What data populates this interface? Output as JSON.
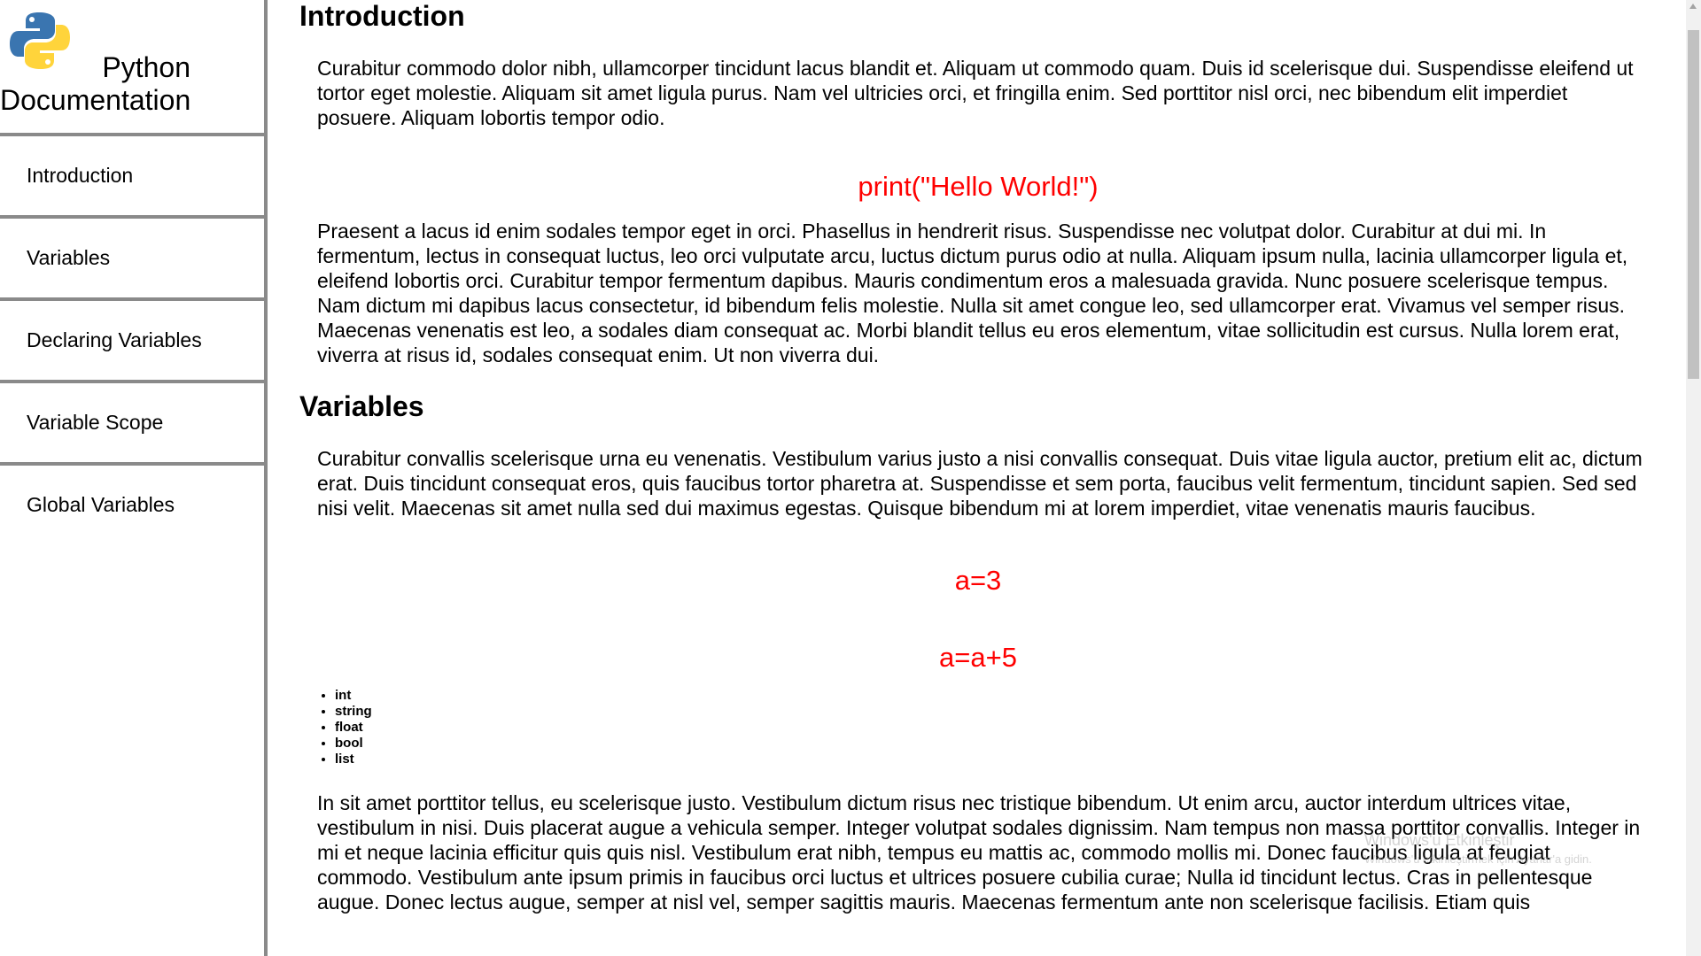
{
  "sidebar": {
    "title": "Python Documentation",
    "logo": "python-logo",
    "items": [
      {
        "label": "Introduction"
      },
      {
        "label": "Variables"
      },
      {
        "label": "Declaring Variables"
      },
      {
        "label": "Variable Scope"
      },
      {
        "label": "Global Variables"
      }
    ]
  },
  "main": {
    "introduction": {
      "title": "Introduction",
      "para1": "Curabitur commodo dolor nibh, ullamcorper tincidunt lacus blandit et. Aliquam ut commodo quam. Duis id scelerisque dui. Suspendisse eleifend ut tortor eget molestie. Aliquam sit amet ligula purus. Nam vel ultricies orci, et fringilla enim. Sed porttitor nisl orci, nec bibendum elit imperdiet posuere. Aliquam lobortis tempor odio.",
      "code": "print(\"Hello World!\")",
      "para2": "Praesent a lacus id enim sodales tempor eget in orci. Phasellus in hendrerit risus. Suspendisse nec volutpat dolor. Curabitur at dui mi. In fermentum, lectus in consequat luctus, leo orci vulputate arcu, luctus dictum purus odio at nulla. Aliquam ipsum nulla, lacinia ullamcorper ligula et, eleifend lobortis orci. Curabitur tempor fermentum dapibus. Mauris condimentum eros a malesuada gravida. Nunc posuere scelerisque tempus. Nam dictum mi dapibus lacus consectetur, id bibendum felis molestie. Nulla sit amet congue leo, sed ullamcorper erat. Vivamus vel semper risus. Maecenas venenatis est leo, a sodales diam consequat ac. Morbi blandit tellus eu eros elementum, vitae sollicitudin est cursus. Nulla lorem erat, viverra at risus id, sodales consequat enim. Ut non viverra dui."
    },
    "variables": {
      "title": "Variables",
      "para1": "Curabitur convallis scelerisque urna eu venenatis. Vestibulum varius justo a nisi convallis consequat. Duis vitae ligula auctor, pretium elit ac, dictum erat. Duis tincidunt consequat eros, quis faucibus tortor pharetra at. Suspendisse et sem porta, faucibus velit fermentum, tincidunt sapien. Sed sed nisi velit. Maecenas sit amet nulla sed dui maximus egestas. Quisque bibendum mi at lorem imperdiet, vitae venenatis mauris faucibus.",
      "code1": "a=3",
      "code2": "a=a+5",
      "types": [
        "int",
        "string",
        "float",
        "bool",
        "list"
      ],
      "para2": "In sit amet porttitor tellus, eu scelerisque justo. Vestibulum dictum risus nec tristique bibendum. Ut enim arcu, auctor interdum ultrices vitae, vestibulum in nisi. Duis placerat augue a vehicula semper. Integer volutpat sodales dignissim. Nam tempus non massa porttitor convallis. Integer in mi et neque lacinia efficitur quis quis nisl. Vestibulum erat nibh, tempus eu mattis ac, commodo mollis mi. Donec faucibus ligula at feugiat commodo. Vestibulum ante ipsum primis in faucibus orci luctus et ultrices posuere cubilia curae; Nulla id tincidunt lectus. Cras in pellentesque augue. Donec lectus augue, semper at nisl vel, semper sagittis mauris. Maecenas fermentum ante non scelerisque facilisis. Etiam quis"
    }
  },
  "watermark": {
    "line1": "Windows'u Etkinleştir",
    "line2": "Windows'u etkinleştirmek için Ayarlar'a gidin."
  },
  "colors": {
    "code": "#ff0000",
    "border": "#8a8a8a",
    "python_blue": "#3a75b0",
    "python_yellow": "#ffd43b"
  }
}
